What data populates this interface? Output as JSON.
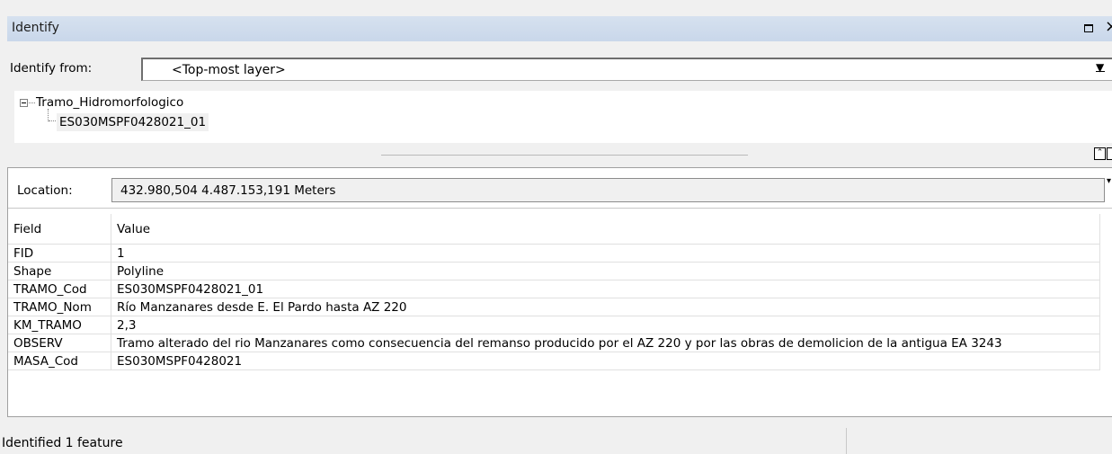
{
  "window": {
    "title": "Identify",
    "maximize_icon": "maximize-icon",
    "close_icon": "close-icon",
    "close_glyph": "×"
  },
  "identify_from": {
    "label": "Identify from:",
    "selected": "<Top-most layer>"
  },
  "tree": {
    "layer": "Tramo_Hidromorfologico",
    "feature": "ES030MSPF0428021_01"
  },
  "location": {
    "label": "Location:",
    "value": "432.980,504  4.487.153,191 Meters"
  },
  "attributes": {
    "headers": {
      "field": "Field",
      "value": "Value"
    },
    "rows": [
      {
        "field": "FID",
        "value": "1"
      },
      {
        "field": "Shape",
        "value": "Polyline"
      },
      {
        "field": "TRAMO_Cod",
        "value": "ES030MSPF0428021_01"
      },
      {
        "field": "TRAMO_Nom",
        "value": "Río Manzanares desde E. El Pardo hasta AZ 220"
      },
      {
        "field": "KM_TRAMO",
        "value": "2,3"
      },
      {
        "field": "OBSERV",
        "value": "Tramo alterado del rio Manzanares como consecuencia del remanso producido por el AZ 220 y por las obras de demolicion de la antigua EA 3243"
      },
      {
        "field": "MASA_Cod",
        "value": "ES030MSPF0428021"
      }
    ]
  },
  "status": {
    "text": "Identified 1 feature"
  },
  "colors": {
    "titlebar": "#cfdcec",
    "background": "#f0f0f0",
    "selection": "#f0f0f0"
  }
}
